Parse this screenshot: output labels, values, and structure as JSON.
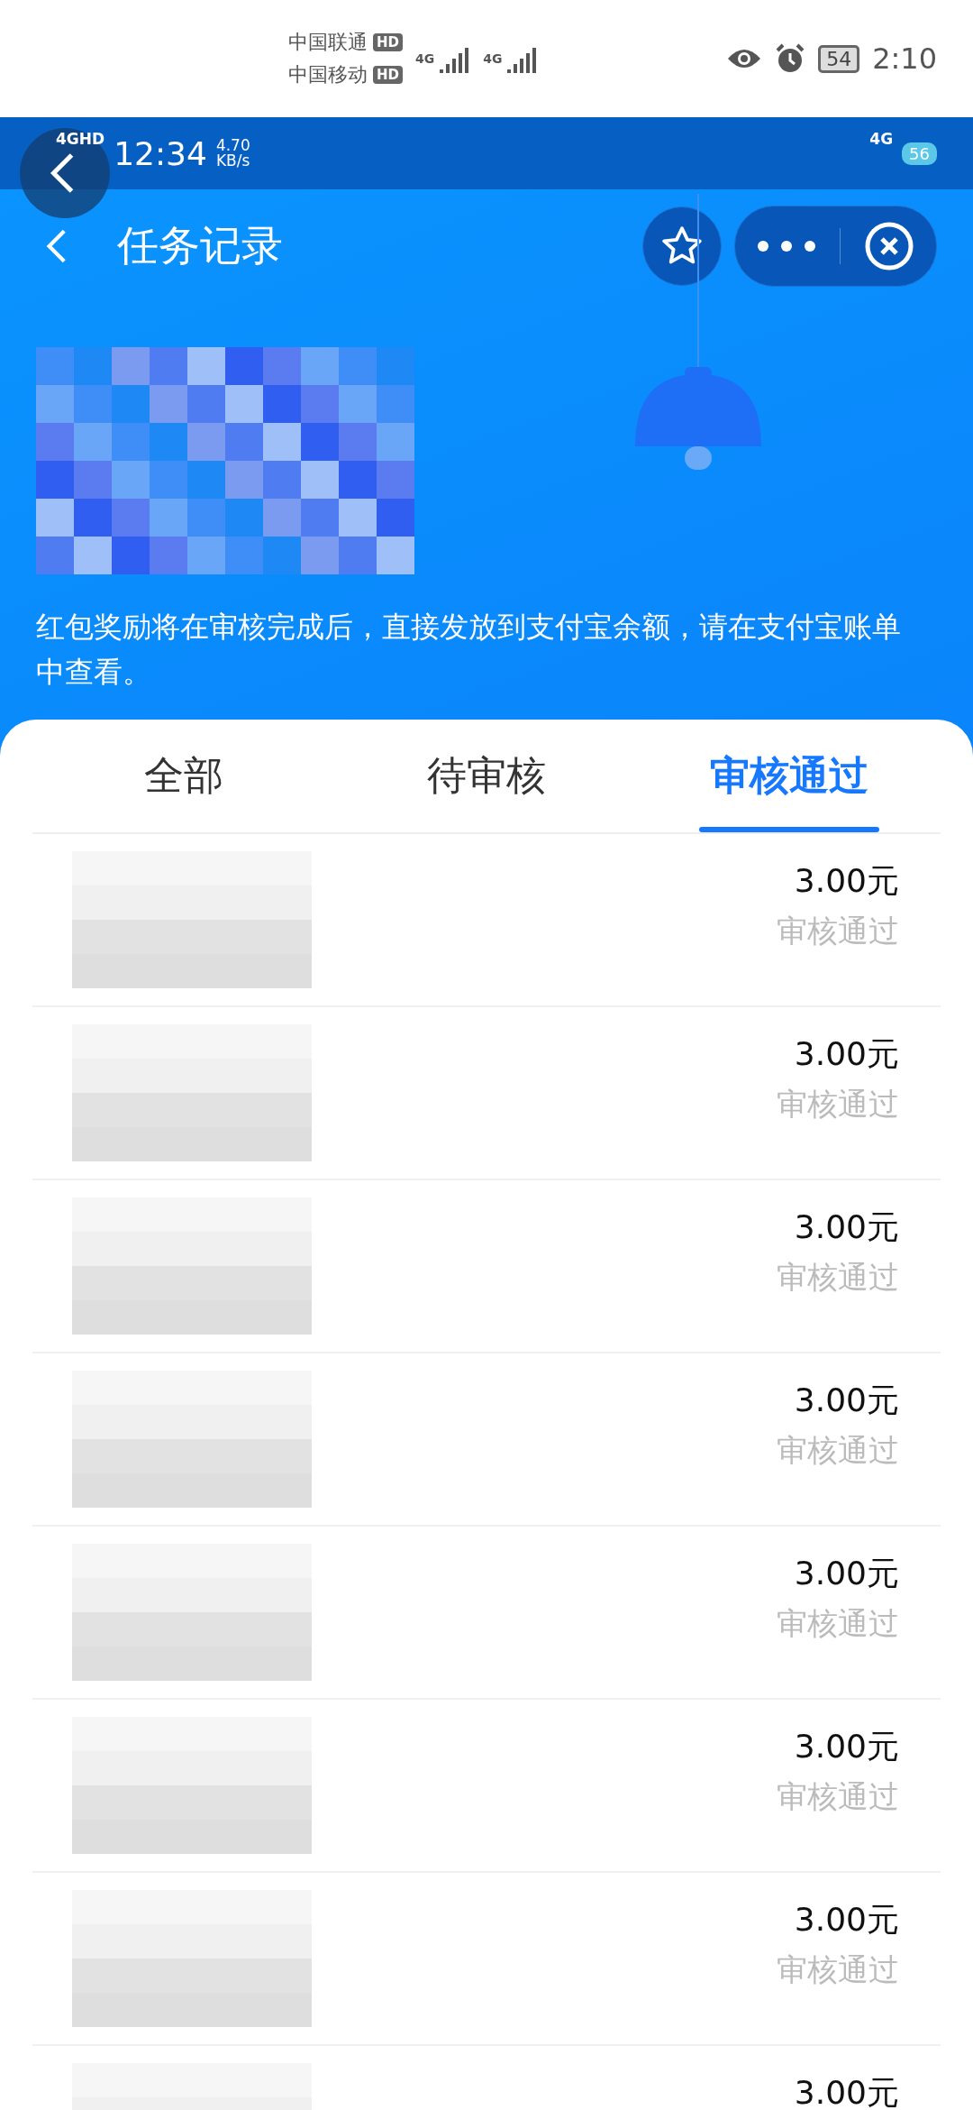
{
  "system_status_bar": {
    "carriers": [
      {
        "name": "中国联通",
        "badge": "HD",
        "network": "4G"
      },
      {
        "name": "中国移动",
        "badge": "HD",
        "network": "4G"
      }
    ],
    "battery": "54",
    "time": "2:10"
  },
  "inner_status_bar": {
    "network": "4GHD",
    "time": "12:34",
    "speed": "4.70",
    "speed_unit": "KB/s",
    "right_network": "4G",
    "right_badge": "56"
  },
  "header": {
    "title": "任务记录"
  },
  "notice": "红包奖励将在审核完成后，直接发放到支付宝余额，请在支付宝账单中查看。",
  "tabs": [
    {
      "label": "全部",
      "selected": false
    },
    {
      "label": "待审核",
      "selected": false
    },
    {
      "label": "审核通过",
      "selected": true
    }
  ],
  "records": [
    {
      "amount": "3.00元",
      "status": "审核通过"
    },
    {
      "amount": "3.00元",
      "status": "审核通过"
    },
    {
      "amount": "3.00元",
      "status": "审核通过"
    },
    {
      "amount": "3.00元",
      "status": "审核通过"
    },
    {
      "amount": "3.00元",
      "status": "审核通过"
    },
    {
      "amount": "3.00元",
      "status": "审核通过"
    },
    {
      "amount": "3.00元",
      "status": "审核通过"
    },
    {
      "amount": "3.00元"
    }
  ]
}
